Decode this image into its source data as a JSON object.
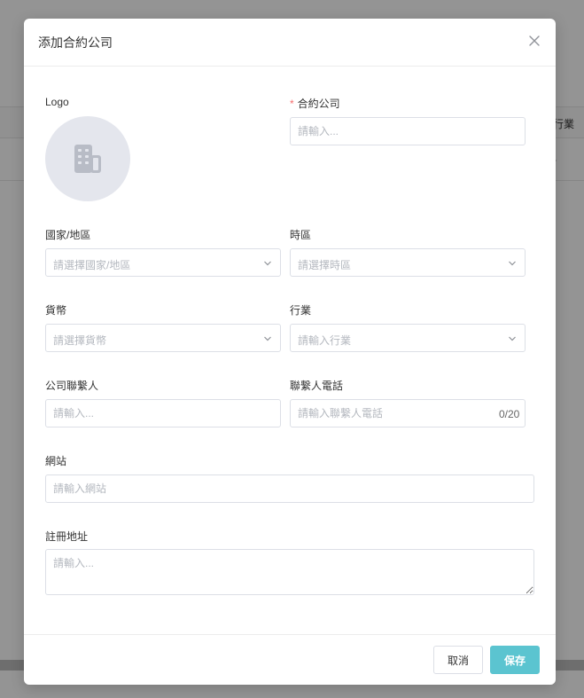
{
  "background": {
    "column_header": "行業",
    "cell_value": "-"
  },
  "modal": {
    "title": "添加合約公司",
    "close_icon": "close-icon",
    "colors": {
      "accent": "#5bc4d0",
      "required": "#f56c6c",
      "avatar_bg": "#e4e6ed"
    }
  },
  "form": {
    "logo": {
      "label": "Logo",
      "icon": "building-icon"
    },
    "company": {
      "label": "合約公司",
      "required": true,
      "placeholder": "請輸入...",
      "value": ""
    },
    "country": {
      "label": "國家/地區",
      "placeholder": "請選擇國家/地區"
    },
    "timezone": {
      "label": "時區",
      "placeholder": "請選擇時區"
    },
    "currency": {
      "label": "貨幣",
      "placeholder": "請選擇貨幣"
    },
    "industry": {
      "label": "行業",
      "placeholder": "請輸入行業"
    },
    "contact": {
      "label": "公司聯繫人",
      "placeholder": "請輸入...",
      "value": ""
    },
    "phone": {
      "label": "聯繫人電話",
      "placeholder": "請輸入聯繫人電話",
      "value": "",
      "counter": "0/20"
    },
    "website": {
      "label": "網站",
      "placeholder": "請輸入網站",
      "value": ""
    },
    "address": {
      "label": "註冊地址",
      "placeholder": "請輸入...",
      "value": ""
    }
  },
  "footer": {
    "cancel_label": "取消",
    "save_label": "保存"
  }
}
